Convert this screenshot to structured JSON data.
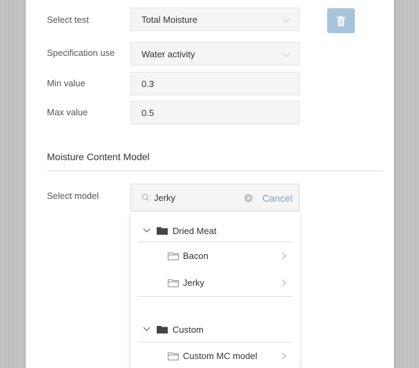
{
  "form": {
    "select_test": {
      "label": "Select test",
      "value": "Total Moisture"
    },
    "specification_use": {
      "label": "Specification use",
      "value": "Water activity"
    },
    "min_value": {
      "label": "Min value",
      "value": "0.3"
    },
    "max_value": {
      "label": "Max value",
      "value": "0.5"
    }
  },
  "section": {
    "title": "Moisture Content Model"
  },
  "model_select": {
    "label": "Select model",
    "search_value": "Jerky",
    "cancel_label": "Cancel"
  },
  "tree": {
    "groups": [
      {
        "name": "Dried Meat",
        "items": [
          {
            "label": "Bacon"
          },
          {
            "label": "Jerky"
          }
        ]
      },
      {
        "name": "Custom",
        "items": [
          {
            "label": "Custom MC model"
          }
        ]
      }
    ]
  },
  "colors": {
    "delete_button": "#a8c4da",
    "cancel_link": "#7ea4c2",
    "side_gutter": "#c6c6c6"
  },
  "icons": {
    "delete": "trash-icon",
    "search": "search-icon",
    "clear": "clear-icon",
    "group_folder": "folder-filled-icon",
    "item_folder": "folder-outline-icon"
  }
}
